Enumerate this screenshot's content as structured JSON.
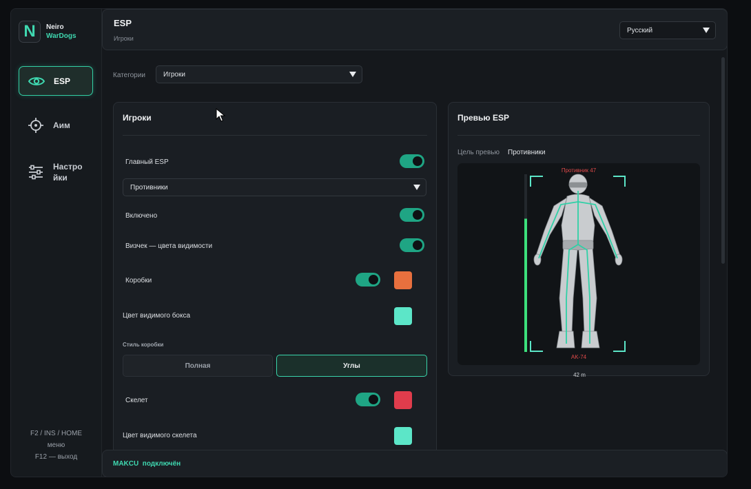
{
  "brand": {
    "logo_letter": "N",
    "name": "Neiro",
    "product": "WarDogs"
  },
  "sidebar": {
    "items": [
      {
        "label": "ESP",
        "icon": "eye-icon",
        "active": true
      },
      {
        "label": "Аим",
        "icon": "crosshair-icon",
        "active": false
      },
      {
        "label": "Настройки",
        "label_lines": [
          "Настро",
          "йки"
        ],
        "icon": "sliders-icon",
        "active": false
      }
    ],
    "hotkeys": {
      "line1": "F2 / INS / HOME",
      "line2": "меню",
      "line3": "F12 — выход"
    }
  },
  "header": {
    "title": "ESP",
    "subtitle": "Игроки",
    "language": "Русский"
  },
  "category": {
    "label": "Категории",
    "value": "Игроки"
  },
  "players_panel": {
    "title": "Игроки",
    "main_esp_label": "Главный ESP",
    "main_esp_on": true,
    "target_select": "Противники",
    "enabled_label": "Включено",
    "enabled_on": true,
    "visibility_label": "Визчек — цвета видимости",
    "visibility_on": true,
    "boxes_label": "Коробки",
    "boxes_on": true,
    "boxes_color": "#e8703e",
    "visible_box_color_label": "Цвет видимого бокса",
    "visible_box_color": "#5ce6c8",
    "box_style_label": "Стиль коробки",
    "box_style_options": [
      "Полная",
      "Углы"
    ],
    "box_style_selected": "Углы",
    "skeleton_label": "Скелет",
    "skeleton_on": true,
    "skeleton_color": "#e03c4c",
    "visible_skeleton_color_label": "Цвет видимого скелета",
    "visible_skeleton_color": "#5ce6c8"
  },
  "preview_panel": {
    "title": "Превью ESP",
    "target_label": "Цель превью",
    "target_value": "Противники",
    "enemy_name": "Противник 47",
    "weapon": "AK-74",
    "distance": "42 m",
    "health_fraction": 0.75
  },
  "status": {
    "text": "MAKCU  подключён"
  },
  "colors": {
    "accent": "#33d1a6",
    "toggle_on": "#1fa584",
    "enemy_text": "#e04a4a"
  }
}
